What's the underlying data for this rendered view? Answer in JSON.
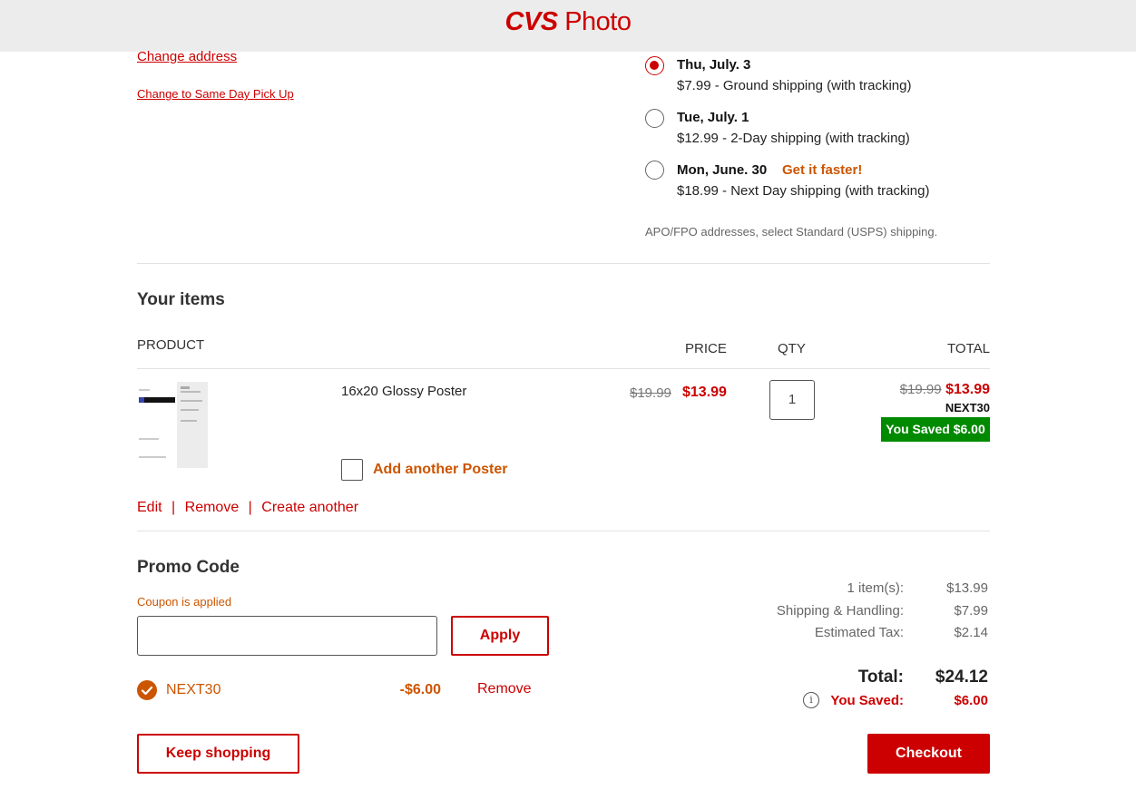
{
  "header": {
    "brand_bold": "CVS",
    "brand_rest": " Photo"
  },
  "address": {
    "change_address": "Change address",
    "same_day": "Change to Same Day Pick Up"
  },
  "shipping": {
    "options": [
      {
        "date": "Thu, July. 3",
        "desc": "$7.99 - Ground shipping (with tracking)",
        "selected": true,
        "badge": ""
      },
      {
        "date": "Tue, July. 1",
        "desc": "$12.99 - 2-Day shipping (with tracking)",
        "selected": false,
        "badge": ""
      },
      {
        "date": "Mon, June. 30",
        "desc": "$18.99 - Next Day shipping (with tracking)",
        "selected": false,
        "badge": "Get it faster!"
      }
    ],
    "note": "APO/FPO addresses, select Standard (USPS) shipping."
  },
  "items": {
    "title": "Your items",
    "headers": {
      "product": "PRODUCT",
      "price": "PRICE",
      "qty": "QTY",
      "total": "TOTAL"
    },
    "rows": [
      {
        "name": "16x20 Glossy Poster",
        "orig_price": "$19.99",
        "price": "$13.99",
        "qty": "1",
        "total_orig": "$19.99",
        "total": "$13.99",
        "code": "NEXT30",
        "saved": "You Saved $6.00",
        "add_another": "Add another Poster"
      }
    ],
    "actions": {
      "edit": "Edit",
      "sep": "|",
      "remove": "Remove",
      "create": "Create another"
    }
  },
  "promo": {
    "title": "Promo Code",
    "status": "Coupon is applied",
    "input_value": "",
    "apply": "Apply",
    "applied_code": "NEXT30",
    "applied_amount": "-$6.00",
    "remove": "Remove"
  },
  "summary": {
    "items_label": "1 item(s):",
    "items_value": "$13.99",
    "shipping_label": "Shipping & Handling:",
    "shipping_value": "$7.99",
    "tax_label": "Estimated Tax:",
    "tax_value": "$2.14",
    "total_label": "Total:",
    "total_value": "$24.12",
    "saved_label": "You Saved:",
    "saved_value": "$6.00"
  },
  "buttons": {
    "keep_shopping": "Keep shopping",
    "checkout": "Checkout"
  },
  "colors": {
    "brand_red": "#cc0000",
    "accent_orange": "#cc5500",
    "saved_green": "#008a00"
  }
}
